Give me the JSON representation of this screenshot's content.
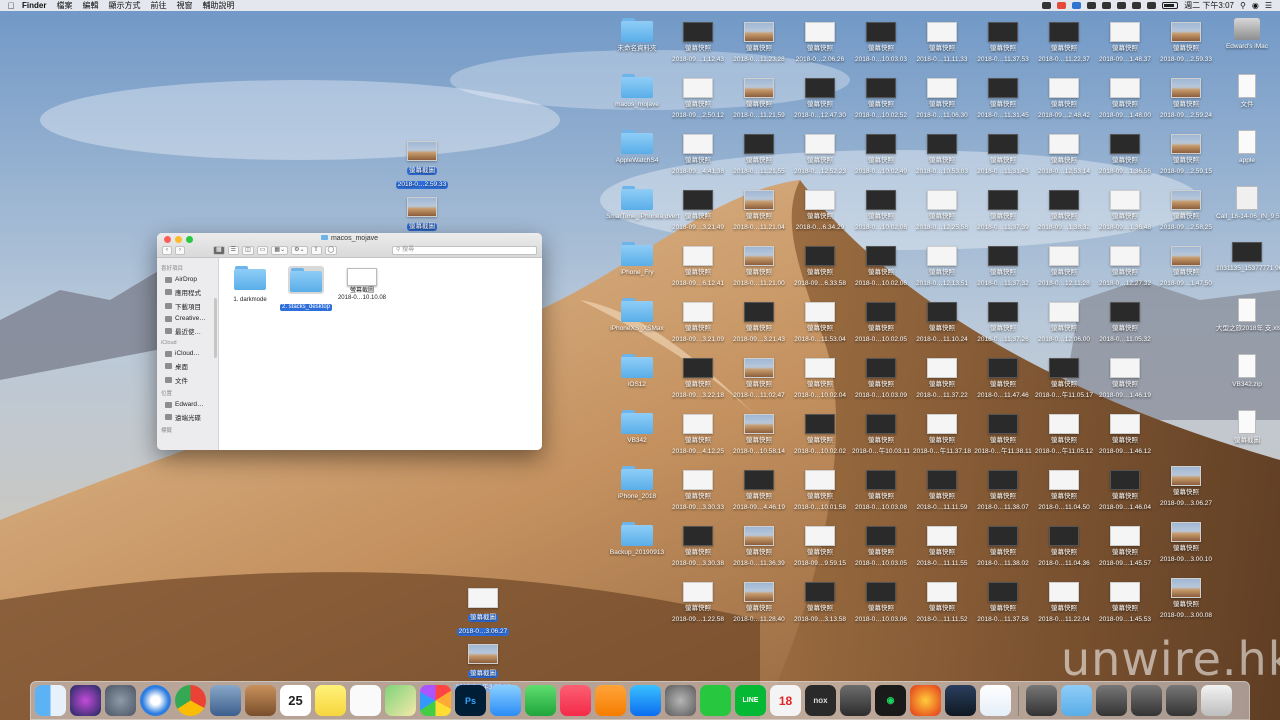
{
  "menubar": {
    "apple_icon": "apple-icon",
    "app_name": "Finder",
    "menus": [
      "檔案",
      "編輯",
      "顯示方式",
      "前往",
      "視窗",
      "輔助說明"
    ],
    "clock": "週二 下午3:07"
  },
  "desktop": {
    "folders": [
      "未命名資料夾",
      "macos_mojave",
      "AppleWatchS4",
      "SmarTone_iPhonea dvert",
      "iPhone_Fry",
      "iPhoneXS_XSMax",
      "iOS12",
      "VB342",
      "iPhone_2018",
      "Backup_20190913"
    ],
    "right_column": [
      "Edward's iMac",
      "文件",
      "apple",
      "Call_18-14-06_IN_9 5098126.amr",
      "1031135_15377771 96908_n.mp4",
      "大型之旅2018年 支.xlsx",
      "VB342.zip",
      "螢幕截圖"
    ],
    "screenshot_label": "螢幕快照",
    "screenshot_dates": [
      "2018-09…1.12.43",
      "2018-0…11.23.28",
      "2018-0…2.06.26",
      "2018-0…10.03.03",
      "2018-0…11.11.33",
      "2018-0…11.37.53",
      "2018-0…11.22.37",
      "2018-09…1.48.37",
      "2018-09…2.50.12",
      "2018-0…11.21.59",
      "2018-0…12.47.30",
      "2018-0…10.02.52",
      "2018-0…11.06.30",
      "2018-0…11.31.45",
      "2018-09…2.48.42",
      "2018-09…1.48.00",
      "2018-09…4.41.38",
      "2018-0…11.21.55",
      "2018-0…12.52.23",
      "2018-0…10.02.49",
      "2018-0…10.53.03",
      "2018-0…11.31.43",
      "2018-0…12.53.14",
      "2018-09…1.36.56",
      "2018-09…3.21.49",
      "2018-0…11.21.04",
      "2018-0…6.34.29",
      "2018-0…10.02.08",
      "2018-0…12.25.58",
      "2018-0…11.37.39",
      "2018-09…1.38.32",
      "2018-09…1.36.48",
      "2018-09…6.12.41",
      "2018-0…11.21.00",
      "2018-09…6.33.58",
      "2018-0…10.02.06",
      "2018-0…12.13.51",
      "2018-0…11.37.32",
      "2018-0…12.11.28",
      "2018-0…12.27.32",
      "2018-09…3.21.09",
      "2018-09…3.21.43",
      "2018-0…11.53.04",
      "2018-0…10.02.05",
      "2018-0…11.10.24",
      "2018-0…11.37.26",
      "2018-0…12.06.00",
      "2018-0…11.05.32",
      "2018-09…3.22.18",
      "2018-0…11.02.47",
      "2018-0…10.02.04",
      "2018-0…10.03.09",
      "2018-0…11.37.22",
      "2018-0…11.47.46",
      "2018-0…午11.05.17",
      "2018-09…1.46.19",
      "2018-09…4.12.25",
      "2018-0…10.58.14",
      "2018-0…10.02.02",
      "2018-0…午10.03.11",
      "2018-0…午11.37.18",
      "2018-0…午11.38.11",
      "2018-0…午11.05.12",
      "2018-09…1.46.12",
      "2018-09…3.30.33",
      "2018-09…4.46.19",
      "2018-0…10.01.58",
      "2018-0…10.03.08",
      "2018-0…11.11.59",
      "2018-0…11.38.07",
      "2018-0…11.04.50",
      "2018-09…1.46.04",
      "2018-09…3.30.38",
      "2018-0…11.36.39",
      "2018-09…9.59.15",
      "2018-0…10.03.05",
      "2018-0…11.11.55",
      "2018-0…11.38.02",
      "2018-0…11.04.36",
      "2018-09…1.45.57",
      "2018-09…1.22.58",
      "2018-0…11.28.40",
      "2018-09…3.13.58",
      "2018-0…10.03.06",
      "2018-0…11.11.52",
      "2018-0…11.37.58",
      "2018-0…11.22.04",
      "2018-09…1.45.53"
    ],
    "right_edge_screens": [
      "2018-09…2.59.33",
      "2018-09…2.59.24",
      "2018-09…2.59.15",
      "2018-09…2.58.25",
      "2018-09…1.47.50",
      "2018-09…3.06.27",
      "2018-09…3.00.10",
      "2018-09…3.00.08"
    ],
    "dragged_label": "螢幕截圖",
    "dragged_items": [
      "2018-0…2.59.33",
      "2018-0…2.59.24",
      "2018-0…午2.59.15",
      "2018-0…2.58.25"
    ],
    "bottom_dragged": [
      "2018-0…3.06.27",
      "2018-0…午3.00.10"
    ]
  },
  "finder": {
    "title": "macos_mojave",
    "search_placeholder": "搜尋",
    "sidebar": {
      "favorites_head": "喜好項目",
      "favorites": [
        "AirDrop",
        "應用程式",
        "下載項目",
        "Creative…",
        "最近使…"
      ],
      "icloud_head": "iCloud",
      "icloud": [
        "iCloud…",
        "桌面",
        "文件"
      ],
      "locations_head": "位置",
      "locations": [
        "Edward…",
        "遠端光碟"
      ],
      "tags_head": "標籤"
    },
    "items": [
      {
        "label": "1. darkmode",
        "selected": false
      },
      {
        "label": "2. stacks_desktop",
        "selected": true
      },
      {
        "label": "螢幕截圖",
        "sublabel": "2018-0…10.10.08",
        "selected": false
      }
    ]
  },
  "dock": {
    "apps": [
      "finder-icon",
      "siri-icon",
      "launchpad-icon",
      "safari-icon",
      "chrome-icon",
      "preview-icon",
      "contacts-icon",
      "calendar-icon",
      "notes-icon",
      "reminders-icon",
      "maps-icon",
      "photos-icon",
      "photoshop-icon",
      "messages-icon",
      "facetime-icon",
      "music-icon",
      "books-icon",
      "appstore-icon",
      "system-preferences-icon",
      "whatsapp-icon",
      "line-icon",
      "game-18-icon",
      "nox-icon",
      "calculator-icon",
      "spotify-icon",
      "fire-icon",
      "steam-icon",
      "teamviewer-icon"
    ],
    "calendar_day": "25",
    "calendar_month": "9月",
    "game_badge": "18",
    "nox_label": "nox",
    "line_label": "LINE",
    "ps_label": "Ps"
  },
  "watermark": "unwire.hk",
  "colors": {
    "selection": "#2f6fdc",
    "folder": "#6cb4ea"
  }
}
